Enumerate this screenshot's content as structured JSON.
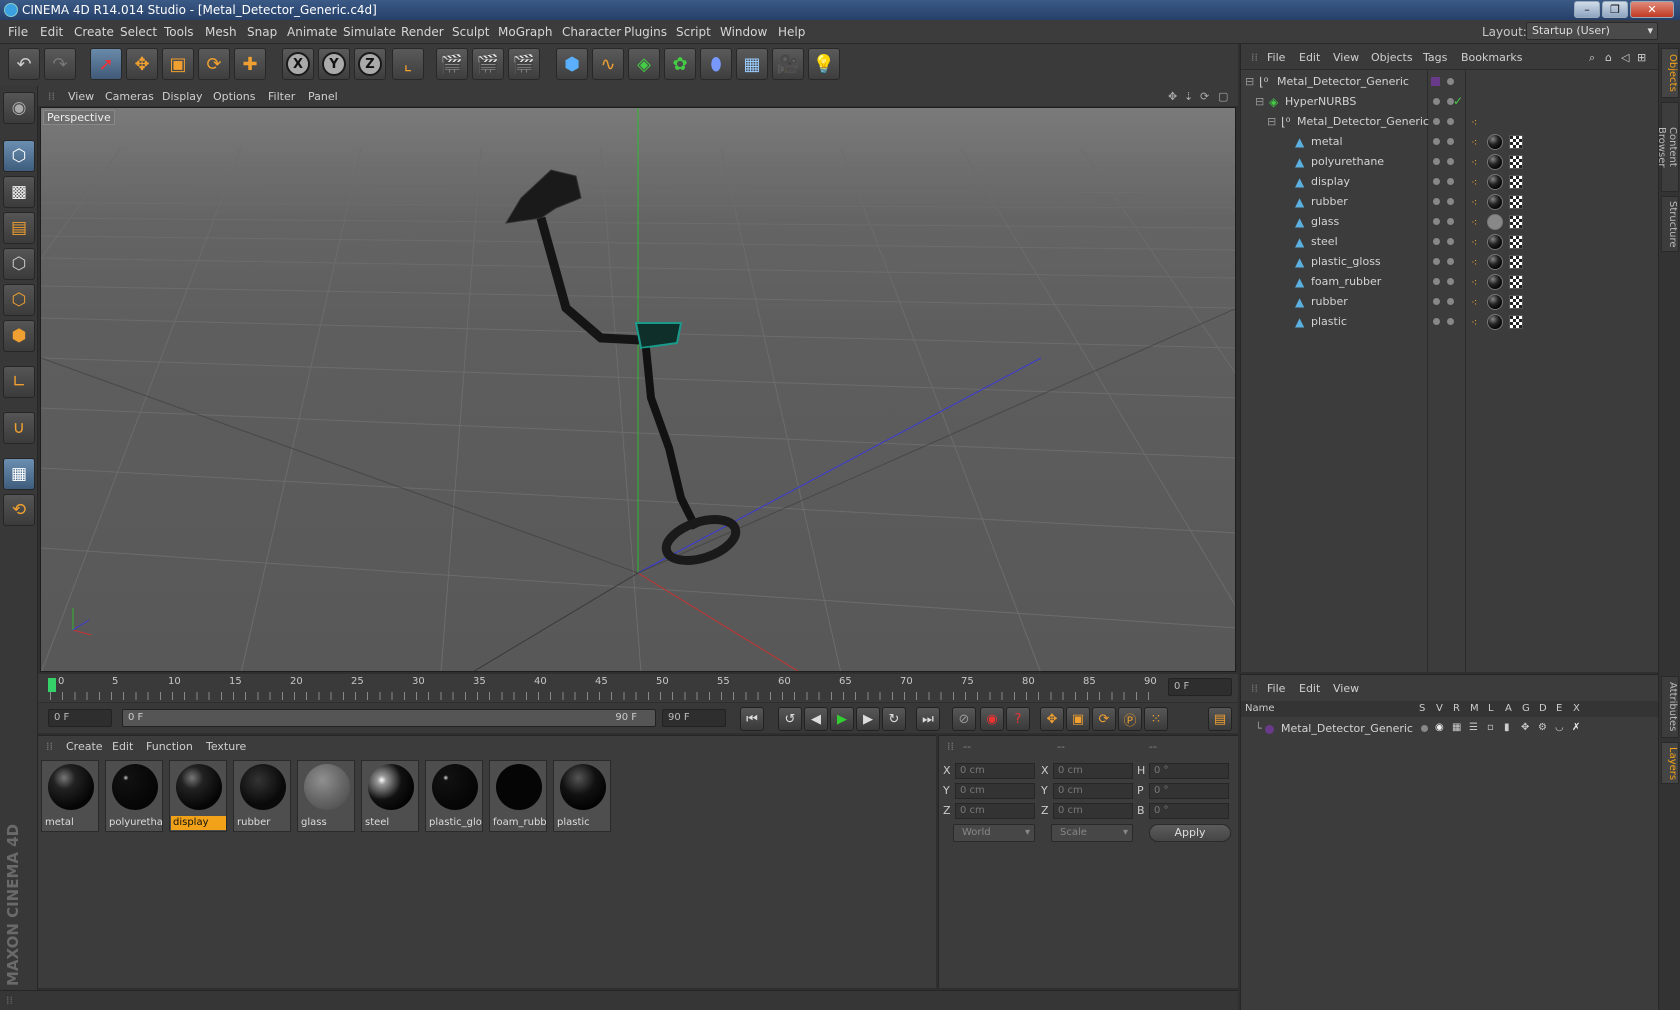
{
  "window": {
    "title": "CINEMA 4D R14.014 Studio - [Metal_Detector_Generic.c4d]",
    "minimize": "–",
    "maximize": "❐",
    "close": "✕"
  },
  "menubar": [
    "File",
    "Edit",
    "Create",
    "Select",
    "Tools",
    "Mesh",
    "Snap",
    "Animate",
    "Simulate",
    "Render",
    "Sculpt",
    "MoGraph",
    "Character",
    "Plugins",
    "Script",
    "Window",
    "Help"
  ],
  "layout": {
    "label": "Layout:",
    "value": "Startup (User)"
  },
  "toolbar_axes": [
    "X",
    "Y",
    "Z"
  ],
  "viewport": {
    "menu": [
      "View",
      "Cameras",
      "Display",
      "Options",
      "Filter",
      "Panel"
    ],
    "label": "Perspective"
  },
  "timeline": {
    "ticks": [
      "0",
      "5",
      "10",
      "15",
      "20",
      "25",
      "30",
      "35",
      "40",
      "45",
      "50",
      "55",
      "60",
      "65",
      "70",
      "75",
      "80",
      "85",
      "90"
    ],
    "current_frame": "0 F",
    "start_field": "0 F",
    "range_start": "0 F",
    "range_end": "90 F",
    "end_field": "90 F"
  },
  "materials": {
    "menu": [
      "Create",
      "Edit",
      "Function",
      "Texture"
    ],
    "items": [
      {
        "label": "metal"
      },
      {
        "label": "polyuretha"
      },
      {
        "label": "display"
      },
      {
        "label": "rubber"
      },
      {
        "label": "glass"
      },
      {
        "label": "steel"
      },
      {
        "label": "plastic_glo"
      },
      {
        "label": "foam_rubb"
      },
      {
        "label": "plastic"
      }
    ],
    "selected": "display"
  },
  "coordinates": {
    "header": [
      "--",
      "--",
      "--"
    ],
    "rows": [
      {
        "a": "X",
        "av": "0 cm",
        "b": "X",
        "bv": "0 cm",
        "c": "H",
        "cv": "0 °"
      },
      {
        "a": "Y",
        "av": "0 cm",
        "b": "Y",
        "bv": "0 cm",
        "c": "P",
        "cv": "0 °"
      },
      {
        "a": "Z",
        "av": "0 cm",
        "b": "Z",
        "bv": "0 cm",
        "c": "B",
        "cv": "0 °"
      }
    ],
    "mode": "World",
    "scale": "Scale",
    "apply": "Apply"
  },
  "objects": {
    "menu": [
      "File",
      "Edit",
      "View",
      "Objects",
      "Tags",
      "Bookmarks"
    ],
    "tree": [
      {
        "name": "Metal_Detector_Generic",
        "level": 0,
        "icon": "null"
      },
      {
        "name": "HyperNURBS",
        "level": 1,
        "icon": "hypernurbs"
      },
      {
        "name": "Metal_Detector_Generic",
        "level": 2,
        "icon": "null"
      },
      {
        "name": "metal",
        "level": 3,
        "icon": "polygon"
      },
      {
        "name": "polyurethane",
        "level": 3,
        "icon": "polygon"
      },
      {
        "name": "display",
        "level": 3,
        "icon": "polygon"
      },
      {
        "name": "rubber",
        "level": 3,
        "icon": "polygon"
      },
      {
        "name": "glass",
        "level": 3,
        "icon": "polygon"
      },
      {
        "name": "steel",
        "level": 3,
        "icon": "polygon"
      },
      {
        "name": "plastic_gloss",
        "level": 3,
        "icon": "polygon"
      },
      {
        "name": "foam_rubber",
        "level": 3,
        "icon": "polygon"
      },
      {
        "name": "rubber",
        "level": 3,
        "icon": "polygon"
      },
      {
        "name": "plastic",
        "level": 3,
        "icon": "polygon"
      }
    ]
  },
  "layers": {
    "menu": [
      "File",
      "Edit",
      "View"
    ],
    "columns": [
      "Name",
      "S",
      "V",
      "R",
      "M",
      "L",
      "A",
      "G",
      "D",
      "E",
      "X"
    ],
    "rows": [
      {
        "name": "Metal_Detector_Generic"
      }
    ]
  },
  "side_tabs": [
    "Objects",
    "Content Browser",
    "Structure",
    "Attributes",
    "Layers"
  ],
  "branding": "MAXON CINEMA 4D",
  "colors": {
    "accent": "#f2a218",
    "selection": "#4d6f94",
    "axis_y": "#2fb82f",
    "axis_x": "#c83232",
    "axis_z": "#3a3ad8"
  }
}
